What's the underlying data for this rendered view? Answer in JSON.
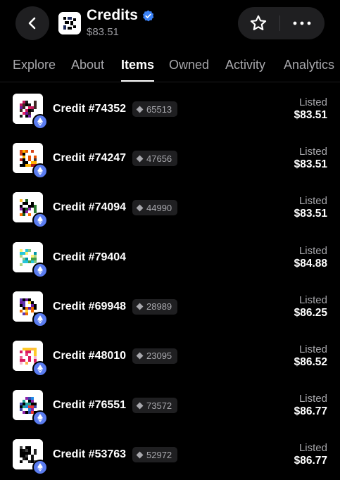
{
  "header": {
    "title": "Credits",
    "floor_price": "$83.51",
    "back_icon": "chevron-left-icon",
    "verified_icon": "verified-badge-icon",
    "favorite_icon": "star-outline-icon",
    "more_icon": "more-horizontal-icon"
  },
  "tabs": [
    {
      "label": "Explore"
    },
    {
      "label": "About"
    },
    {
      "label": "Items",
      "active": true
    },
    {
      "label": "Owned"
    },
    {
      "label": "Activity"
    },
    {
      "label": "Analytics"
    }
  ],
  "items": [
    {
      "name": "Credit #74352",
      "rarity": "65513",
      "status": "Listed",
      "price": "$83.51"
    },
    {
      "name": "Credit #74247",
      "rarity": "47656",
      "status": "Listed",
      "price": "$83.51"
    },
    {
      "name": "Credit #74094",
      "rarity": "44990",
      "status": "Listed",
      "price": "$83.51"
    },
    {
      "name": "Credit #79404",
      "rarity": "",
      "status": "Listed",
      "price": "$84.88"
    },
    {
      "name": "Credit #69948",
      "rarity": "28989",
      "status": "Listed",
      "price": "$86.25"
    },
    {
      "name": "Credit #48010",
      "rarity": "23095",
      "status": "Listed",
      "price": "$86.52"
    },
    {
      "name": "Credit #76551",
      "rarity": "73572",
      "status": "Listed",
      "price": "$86.77"
    },
    {
      "name": "Credit #53763",
      "rarity": "52972",
      "status": "Listed",
      "price": "$86.77"
    }
  ],
  "colors": {
    "background": "#000000",
    "surface": "#1f1f21",
    "muted_text": "#a7a7ab",
    "verified_blue": "#3b82f6",
    "eth_badge": "#5a7cf0"
  }
}
